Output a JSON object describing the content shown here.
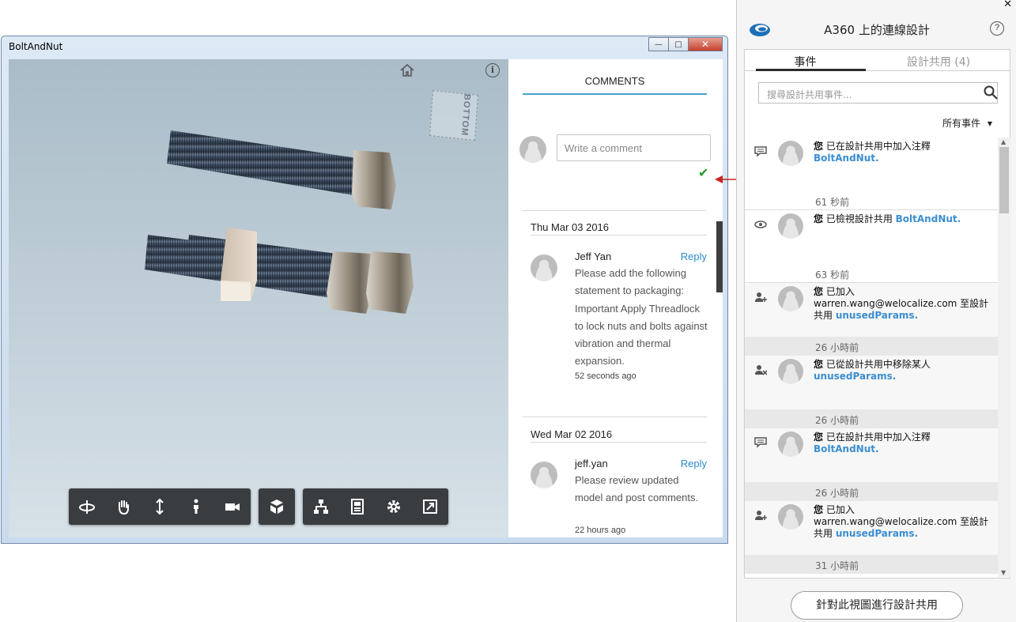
{
  "window": {
    "title": "BoltAndNut"
  },
  "viewcube": {
    "face_label": "BOTTOM"
  },
  "toolbar": {
    "groups": [
      [
        "orbit-icon",
        "pan-icon",
        "zoom-icon",
        "first-person-icon",
        "camera-icon"
      ],
      [
        "explode-icon"
      ],
      [
        "model-browser-icon",
        "properties-icon",
        "settings-icon",
        "fullscreen-icon"
      ]
    ]
  },
  "comments": {
    "header": "COMMENTS",
    "input_placeholder": "Write a comment",
    "groups": [
      {
        "date": "Thu Mar 03 2016",
        "author": "Jeff Yan",
        "reply_label": "Reply",
        "text": "Please add the following statement to packaging: Important Apply Threadlock to lock nuts and bolts against vibration and thermal expansion.",
        "time": "52 seconds ago"
      },
      {
        "date": "Wed Mar 02 2016",
        "author": "jeff.yan",
        "reply_label": "Reply",
        "text": "Please review updated model and post comments.",
        "time": "22 hours ago"
      }
    ]
  },
  "panel": {
    "title": "A360 上的連線設計",
    "help_label": "?",
    "tabs": [
      {
        "label": "事件",
        "active": true
      },
      {
        "label": "設計共用 (4)",
        "active": false
      }
    ],
    "search_placeholder": "搜尋設計共用事件...",
    "filter_label": "所有事件",
    "filter_caret": "▼",
    "share_button": "針對此視圖進行設計共用",
    "events": [
      {
        "icon": "comment-icon",
        "you": "您",
        "text": " 已在設計共用中加入注釋 ",
        "link": "BoltAndNut",
        "suffix": ".",
        "time": "61 秒前"
      },
      {
        "icon": "view-icon",
        "you": "您",
        "text": " 已檢視設計共用 ",
        "link": "BoltAndNut",
        "suffix": ".",
        "time": "63 秒前"
      },
      {
        "icon": "add-user-icon",
        "you": "您",
        "text": " 已加入 warren.wang@welocalize.com 至設計共用 ",
        "link": "unusedParams",
        "suffix": ".",
        "time": "26 小時前"
      },
      {
        "icon": "remove-user-icon",
        "you": "您",
        "text": " 已從設計共用中移除某人 ",
        "link": "unusedParams",
        "suffix": ".",
        "time": "26 小時前"
      },
      {
        "icon": "comment-icon",
        "you": "您",
        "text": " 已在設計共用中加入注釋 ",
        "link": "BoltAndNut",
        "suffix": ".",
        "time": "26 小時前"
      },
      {
        "icon": "add-user-icon",
        "you": "您",
        "text": " 已加入 warren.wang@welocalize.com 至設計共用 ",
        "link": "unusedParams",
        "suffix": ".",
        "time": "31 小時前"
      }
    ]
  },
  "colors": {
    "accent": "#4aa3c5",
    "link": "#3b8ed0",
    "reply": "#2b8ccc",
    "check": "#2a9a2a",
    "arrow": "#cc2222"
  }
}
